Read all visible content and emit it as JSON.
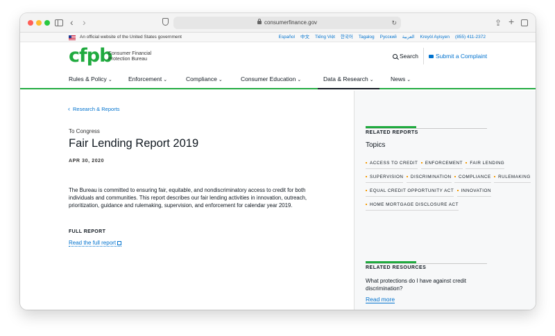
{
  "browser": {
    "url": "consumerfinance.gov"
  },
  "gov_banner": {
    "text": "An official website of the United States government",
    "languages": [
      "Español",
      "中文",
      "Tiếng Việt",
      "한국어",
      "Tagalog",
      "Русский",
      "العربية",
      "Kreyòl Ayisyen",
      "(855) 411-2372"
    ]
  },
  "header": {
    "logo_mark": "cfpb",
    "logo_text": "Consumer Financial Protection Bureau",
    "search_label": "Search",
    "complaint_label": "Submit a Complaint"
  },
  "nav": {
    "items": [
      {
        "label": "Rules & Policy"
      },
      {
        "label": "Enforcement"
      },
      {
        "label": "Compliance"
      },
      {
        "label": "Consumer Education"
      },
      {
        "label": "Data & Research"
      },
      {
        "label": "News"
      }
    ],
    "active": "Data & Research"
  },
  "main": {
    "breadcrumb": "Research & Reports",
    "category": "To Congress",
    "title": "Fair Lending Report 2019",
    "date": "APR 30, 2020",
    "description": "The Bureau is committed to ensuring fair, equitable, and nondiscriminatory access to credit for both individuals and communities. This report describes our fair lending activities in innovation, outreach, prioritization, guidance and rulemaking, supervision, and enforcement for calendar year 2019.",
    "full_report_label": "FULL REPORT",
    "full_report_link": "Read the full report"
  },
  "aside": {
    "related_reports_heading": "RELATED REPORTS",
    "topics_title": "Topics",
    "topics": [
      "ACCESS TO CREDIT",
      "ENFORCEMENT",
      "FAIR LENDING",
      "SUPERVISION",
      "DISCRIMINATION",
      "COMPLIANCE",
      "RULEMAKING",
      "EQUAL CREDIT OPPORTUNITY ACT",
      "INNOVATION",
      "HOME MORTGAGE DISCLOSURE ACT"
    ],
    "related_resources_heading": "RELATED RESOURCES",
    "resource_question": "What protections do I have against credit discrimination?",
    "read_more": "Read more"
  },
  "colors": {
    "brand_green": "#20aa3f",
    "link_blue": "#0072ce",
    "bullet_orange": "#f59a00"
  }
}
